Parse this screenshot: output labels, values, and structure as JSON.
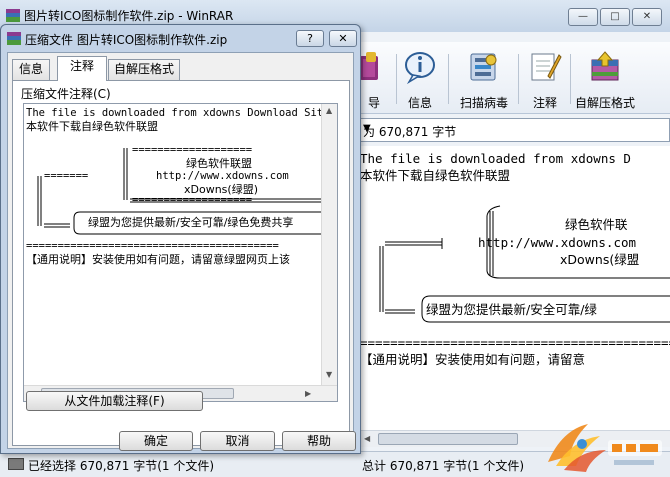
{
  "window": {
    "title": "图片转ICO图标制作软件.zip - WinRAR",
    "caption_buttons": [
      "—",
      "□",
      "✕"
    ]
  },
  "toolbar": {
    "items": [
      {
        "label": "导",
        "icon": "book-icon"
      },
      {
        "label": "信息",
        "icon": "info-icon"
      },
      {
        "label": "扫描病毒",
        "icon": "virus-scan-icon"
      },
      {
        "label": "注释",
        "icon": "comment-icon"
      },
      {
        "label": "自解压格式",
        "icon": "sfx-icon"
      }
    ]
  },
  "pathbar": {
    "text": "为 670,871 字节"
  },
  "main_comment": {
    "lines": [
      "The file is downloaded from xdowns D",
      "本软件下载自绿色软件联盟",
      "绿色软件联",
      "http://www.xdowns.com",
      "xDowns(绿盟",
      "绿盟为您提供最新/安全可靠/绿",
      "===========================================",
      "【通用说明】安装使用如有问题，请留意"
    ]
  },
  "status": {
    "left": "已经选择 670,871 字节(1 个文件)",
    "right": "总计 670,871 字节(1 个文件)"
  },
  "dialog": {
    "title": "压缩文件 图片转ICO图标制作软件.zip",
    "help_btn": "?",
    "close_btn": "✕",
    "tabs": [
      "信息",
      "注释",
      "自解压格式"
    ],
    "comment_label": "压缩文件注释(C)",
    "comment_lines": [
      "The file is downloaded from xdowns Download Site",
      "本软件下载自绿色软件联盟",
      "===================",
      "绿色软件联盟",
      "http://www.xdowns.com",
      "xDowns(绿盟)",
      "=======",
      "===================",
      "绿盟为您提供最新/安全可靠/绿色免费共享",
      "========================================",
      "【通用说明】安装使用如有问题，请留意绿盟网页上该"
    ],
    "load_button": "从文件加载注释(F)",
    "ok": "确定",
    "cancel": "取消",
    "help": "帮助"
  },
  "colors": {
    "title_bg": "#dce7f3",
    "dialog_bg": "#c3d3e7",
    "watermark_orange": "#f08a1c"
  }
}
